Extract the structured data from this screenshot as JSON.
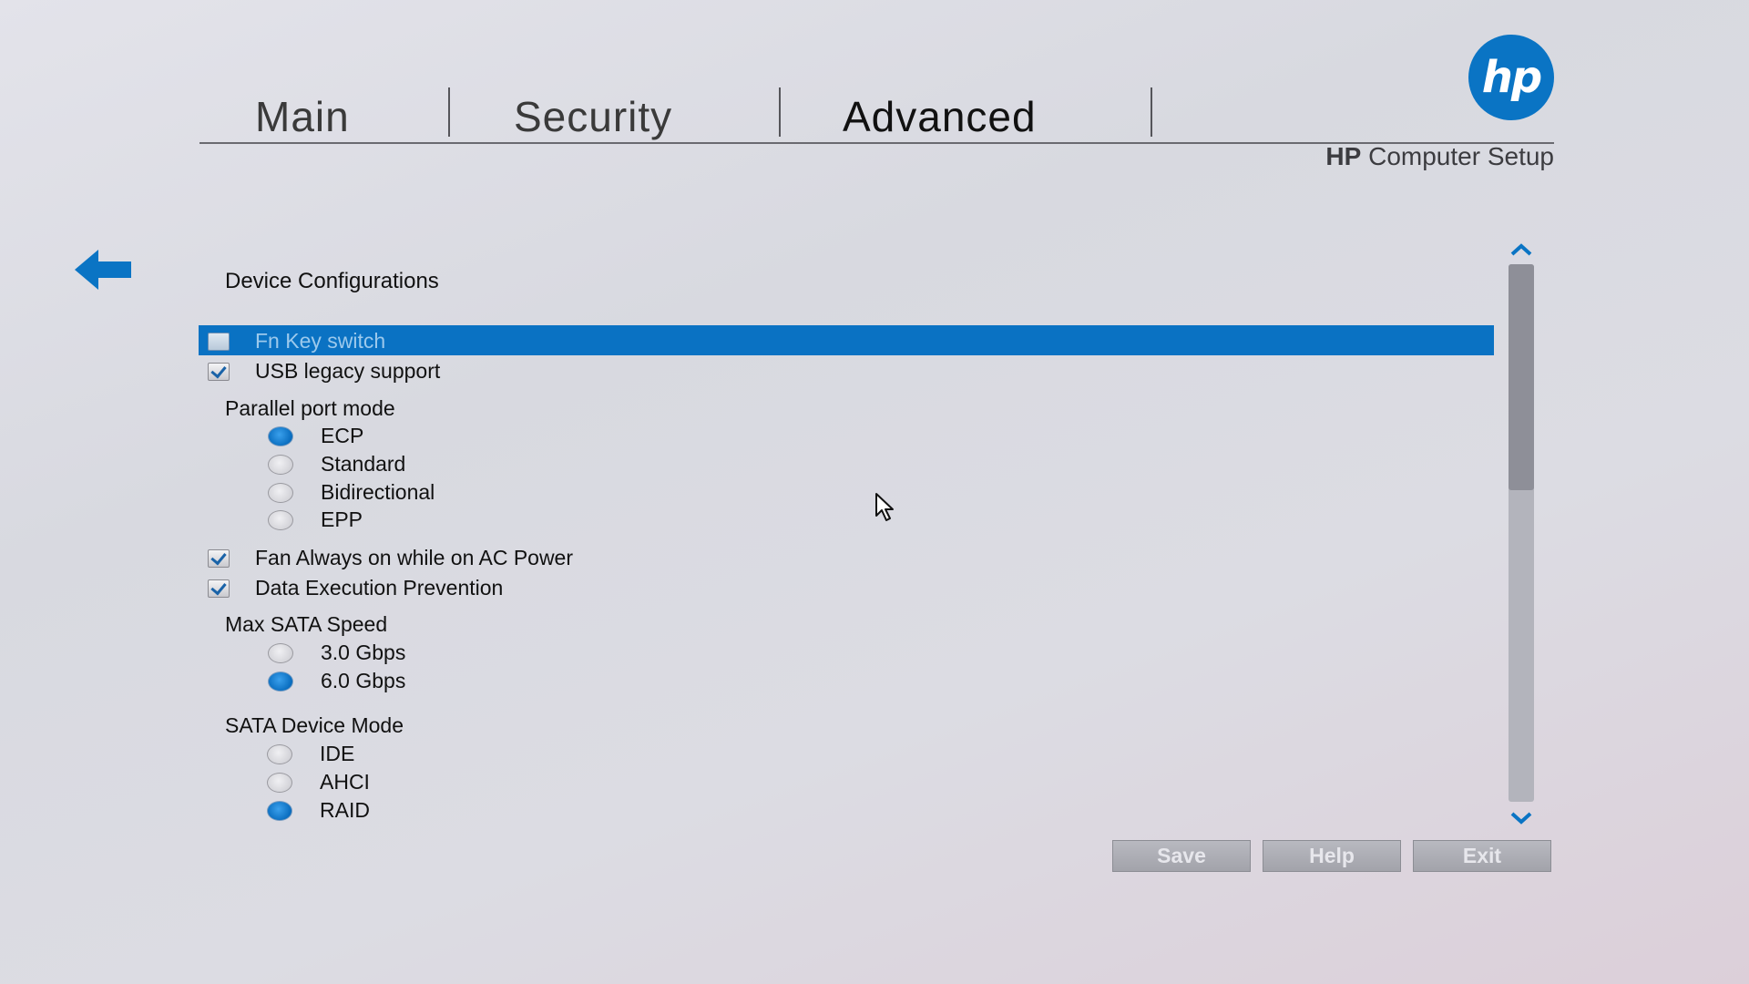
{
  "header": {
    "tabs": [
      {
        "label": "Main",
        "active": false
      },
      {
        "label": "Security",
        "active": false
      },
      {
        "label": "Advanced",
        "active": true
      }
    ],
    "logo_text": "hp",
    "product_brand": "HP",
    "product_name": "Computer Setup",
    "brand_color": "#0a74c4"
  },
  "section": {
    "title": "Device Configurations"
  },
  "settings": {
    "fn_key_switch": {
      "label": "Fn Key switch",
      "checked": false,
      "selected": true
    },
    "usb_legacy": {
      "label": "USB legacy support",
      "checked": true
    },
    "parallel_port": {
      "label": "Parallel port mode",
      "options": [
        "ECP",
        "Standard",
        "Bidirectional",
        "EPP"
      ],
      "selected": "ECP"
    },
    "fan_always_on": {
      "label": "Fan Always on while on AC Power",
      "checked": true
    },
    "dep": {
      "label": "Data Execution Prevention",
      "checked": true
    },
    "max_sata_speed": {
      "label": "Max SATA Speed",
      "options": [
        "3.0 Gbps",
        "6.0 Gbps"
      ],
      "selected": "6.0 Gbps"
    },
    "sata_device_mode": {
      "label": "SATA Device Mode",
      "options": [
        "IDE",
        "AHCI",
        "RAID"
      ],
      "selected": "RAID"
    }
  },
  "buttons": {
    "save": "Save",
    "help": "Help",
    "exit": "Exit"
  },
  "colors": {
    "highlight": "#0a72c3",
    "radio_selected": "#0a6ec0"
  },
  "icons": {
    "back": "left-arrow-icon",
    "scroll_up": "chevron-up-icon",
    "scroll_down": "chevron-down-icon",
    "pointer": "mouse-pointer-icon"
  }
}
